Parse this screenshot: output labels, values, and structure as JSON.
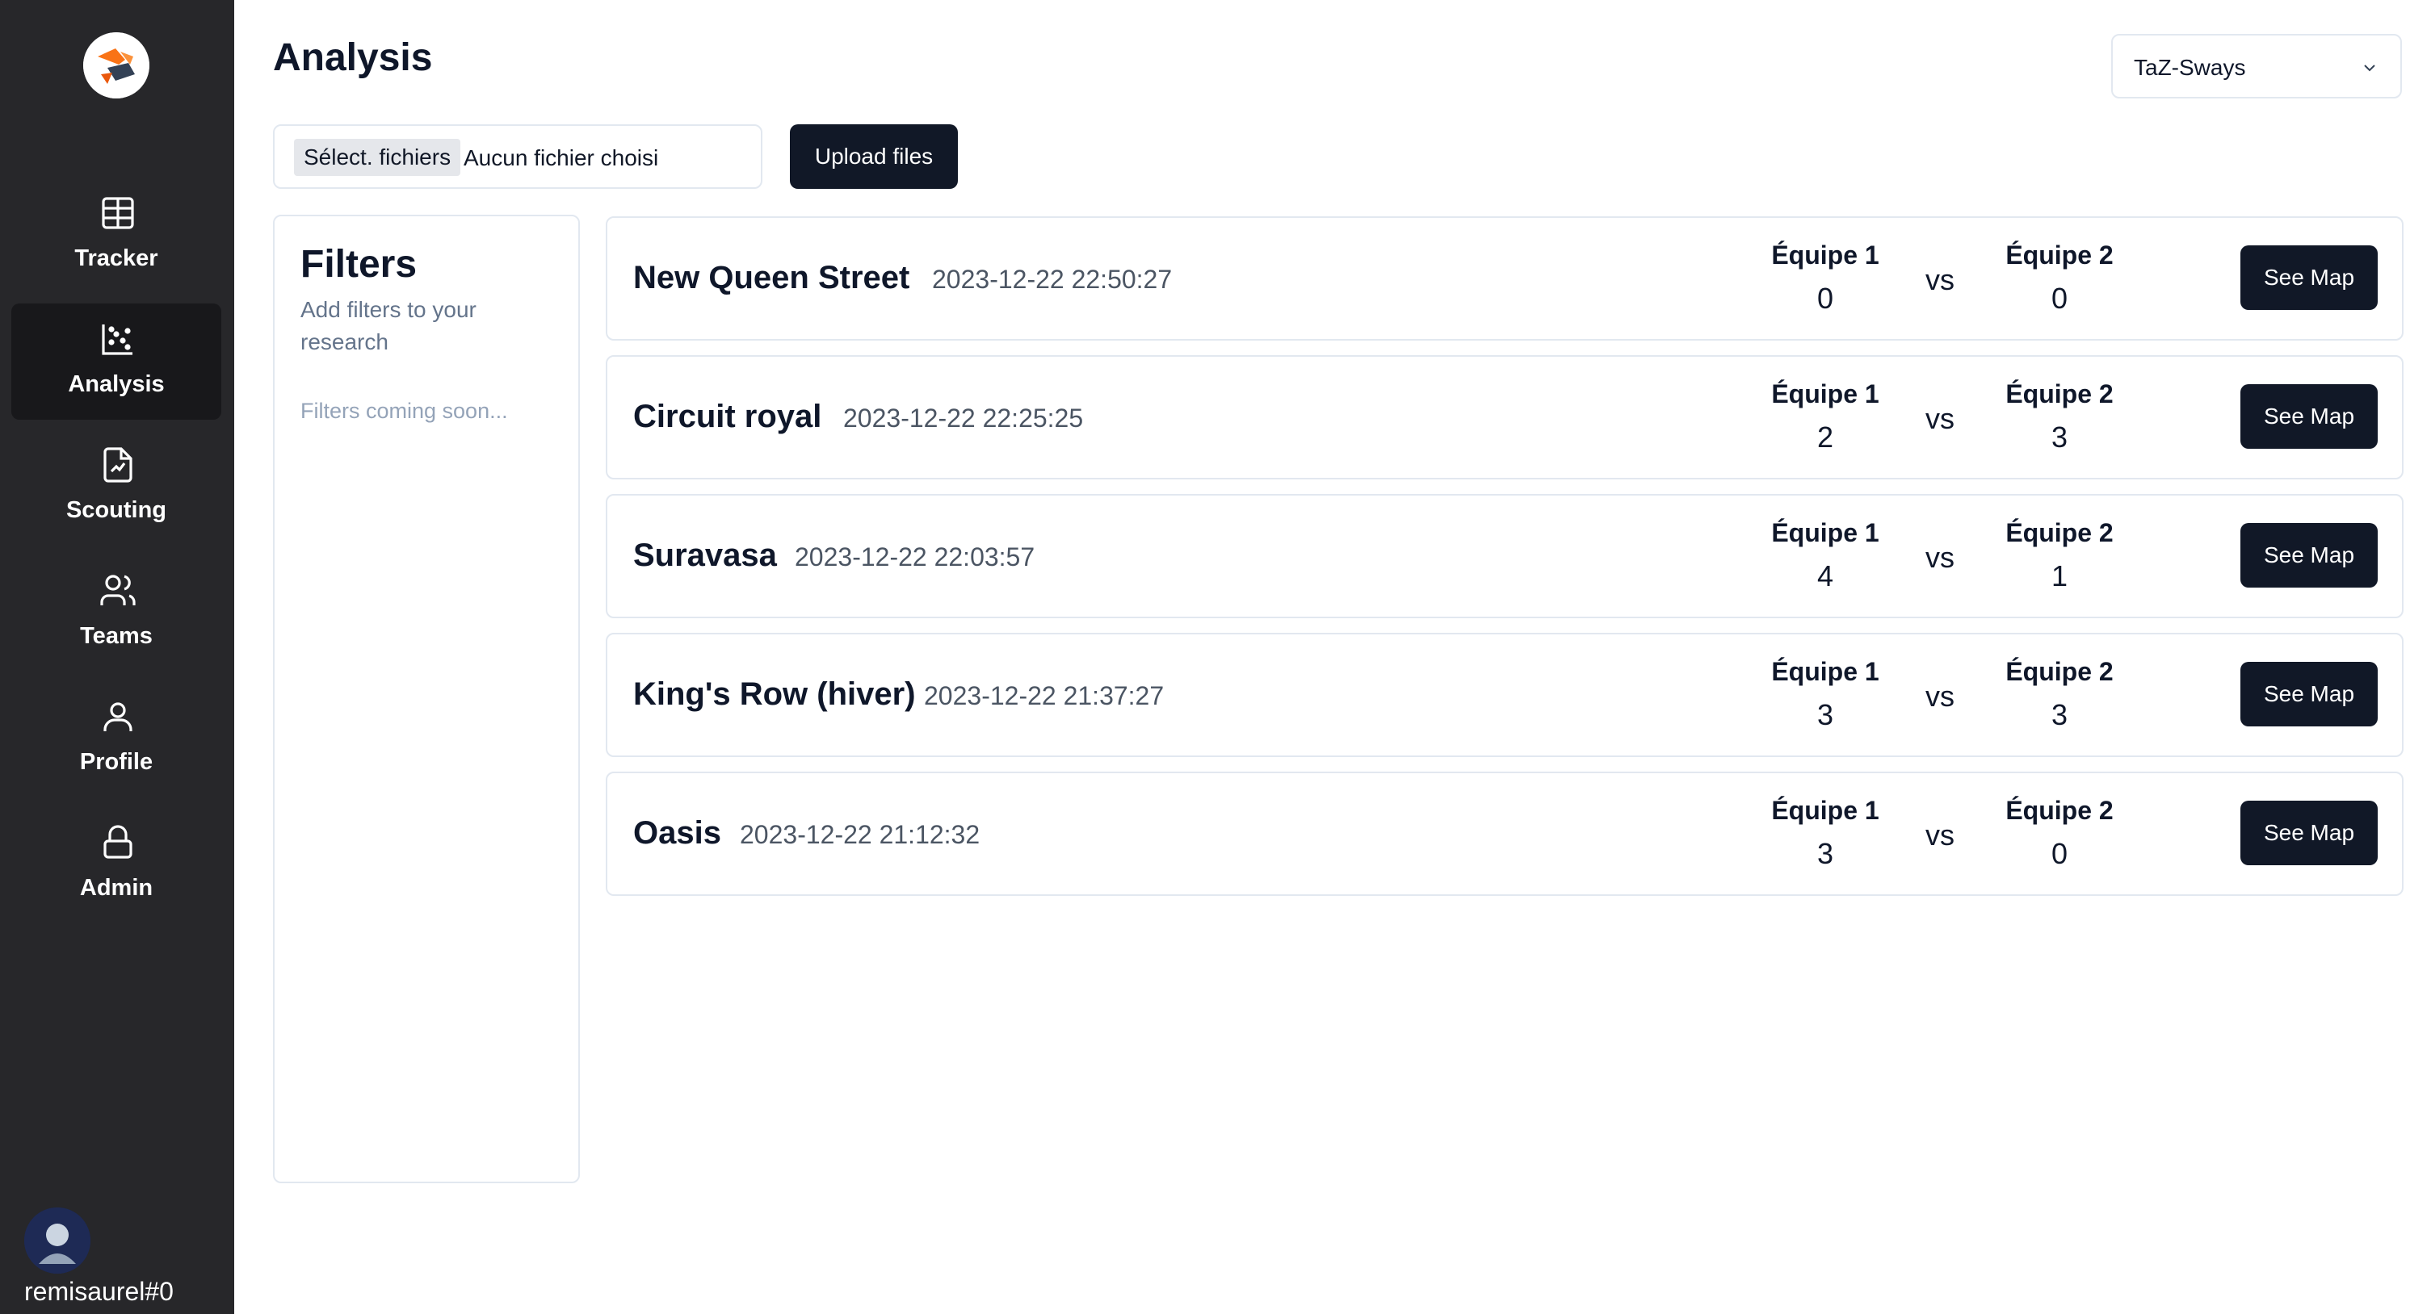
{
  "sidebar": {
    "logo_icon": "overwatch-style-logo",
    "items": [
      {
        "label": "Tracker",
        "icon": "table-icon",
        "active": false
      },
      {
        "label": "Analysis",
        "icon": "scatter-chart-icon",
        "active": true
      },
      {
        "label": "Scouting",
        "icon": "file-chart-icon",
        "active": false
      },
      {
        "label": "Teams",
        "icon": "users-icon",
        "active": false
      },
      {
        "label": "Profile",
        "icon": "user-icon",
        "active": false
      },
      {
        "label": "Admin",
        "icon": "lock-icon",
        "active": false
      }
    ],
    "user": {
      "name": "remisaurel#0",
      "avatar_icon": "user-avatar"
    }
  },
  "header": {
    "title": "Analysis",
    "team_select": {
      "value": "TaZ-Sways"
    }
  },
  "upload": {
    "file_button_label": "Sélect. fichiers",
    "file_status": "Aucun fichier choisi",
    "upload_label": "Upload files"
  },
  "filters": {
    "title": "Filters",
    "description": "Add filters to your research",
    "empty_text": "Filters coming soon..."
  },
  "matches": [
    {
      "map": "New Queen Street",
      "date": "2023-12-22 22:50:27",
      "team1": "Équipe 1",
      "score1": "0",
      "vs": "vs",
      "team2": "Équipe 2",
      "score2": "0",
      "button": "See Map"
    },
    {
      "map": "Circuit royal",
      "date": "2023-12-22 22:25:25",
      "team1": "Équipe 1",
      "score1": "2",
      "vs": "vs",
      "team2": "Équipe 2",
      "score2": "3",
      "button": "See Map"
    },
    {
      "map": "Suravasa",
      "date": "2023-12-22 22:03:57",
      "team1": "Équipe 1",
      "score1": "4",
      "vs": "vs",
      "team2": "Équipe 2",
      "score2": "1",
      "button": "See Map"
    },
    {
      "map": "King's Row (hiver)",
      "date": "2023-12-22 21:37:27",
      "team1": "Équipe 1",
      "score1": "3",
      "vs": "vs",
      "team2": "Équipe 2",
      "score2": "3",
      "button": "See Map"
    },
    {
      "map": "Oasis",
      "date": "2023-12-22 21:12:32",
      "team1": "Équipe 1",
      "score1": "3",
      "vs": "vs",
      "team2": "Équipe 2",
      "score2": "0",
      "button": "See Map"
    }
  ],
  "colors": {
    "sidebar_bg": "#27272a",
    "sidebar_active": "#18181b",
    "primary_button": "#111827",
    "border": "#e2e8f0"
  }
}
